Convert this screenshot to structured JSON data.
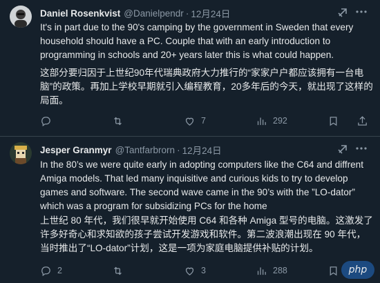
{
  "colors": {
    "background": "#15202b",
    "text": "#e7e9ea",
    "muted": "#8b98a5",
    "divider": "#38444d",
    "avatar1": "#cfd3d6",
    "avatar2": "#2a3a30"
  },
  "tweets": [
    {
      "name": "Daniel Rosenkvist",
      "handle": "@Danielpendr",
      "dot": "·",
      "time": "12月24日",
      "text_en": "It's in part due to the 90's camping by the government in Sweden that every household should have a PC. Couple that with an early introduction to programming in schools and 20+ years later this is what could happen.",
      "text_zh": "这部分要归因于上世纪90年代瑞典政府大力推行的“家家户户都应该拥有一台电脑”的政策。再加上学校早期就引入编程教育，20多年后的今天，就出现了这样的局面。",
      "replies": "",
      "retweets": "",
      "likes": "7",
      "views": "292",
      "icons": [
        "avatar",
        "grok-icon",
        "more-icon",
        "reply-icon",
        "retweet-icon",
        "like-icon",
        "views-icon",
        "bookmark-icon",
        "share-icon"
      ]
    },
    {
      "name": "Jesper Granmyr",
      "handle": "@Tantfarbrorn",
      "dot": "·",
      "time": "12月24日",
      "text_en": "In the 80’s we were quite early in adopting computers like the C64 and diffrent Amiga models. That led many inquisitive and curious kids to try to develop games and software. The second wave came in the 90’s with the ”LO-dator” which was a program for subsidizing PCs for the home",
      "text_zh": "上世纪 80 年代，我们很早就开始使用 C64 和各种 Amiga 型号的电脑。这激发了许多好奇心和求知欲的孩子尝试开发游戏和软件。第二波浪潮出现在 90 年代，当时推出了“LO-dator”计划，这是一项为家庭电脑提供补贴的计划。",
      "replies": "2",
      "retweets": "",
      "likes": "3",
      "views": "288",
      "icons": [
        "avatar",
        "grok-icon",
        "more-icon",
        "reply-icon",
        "retweet-icon",
        "like-icon",
        "views-icon",
        "bookmark-icon",
        "share-icon"
      ]
    }
  ],
  "watermark": "php"
}
